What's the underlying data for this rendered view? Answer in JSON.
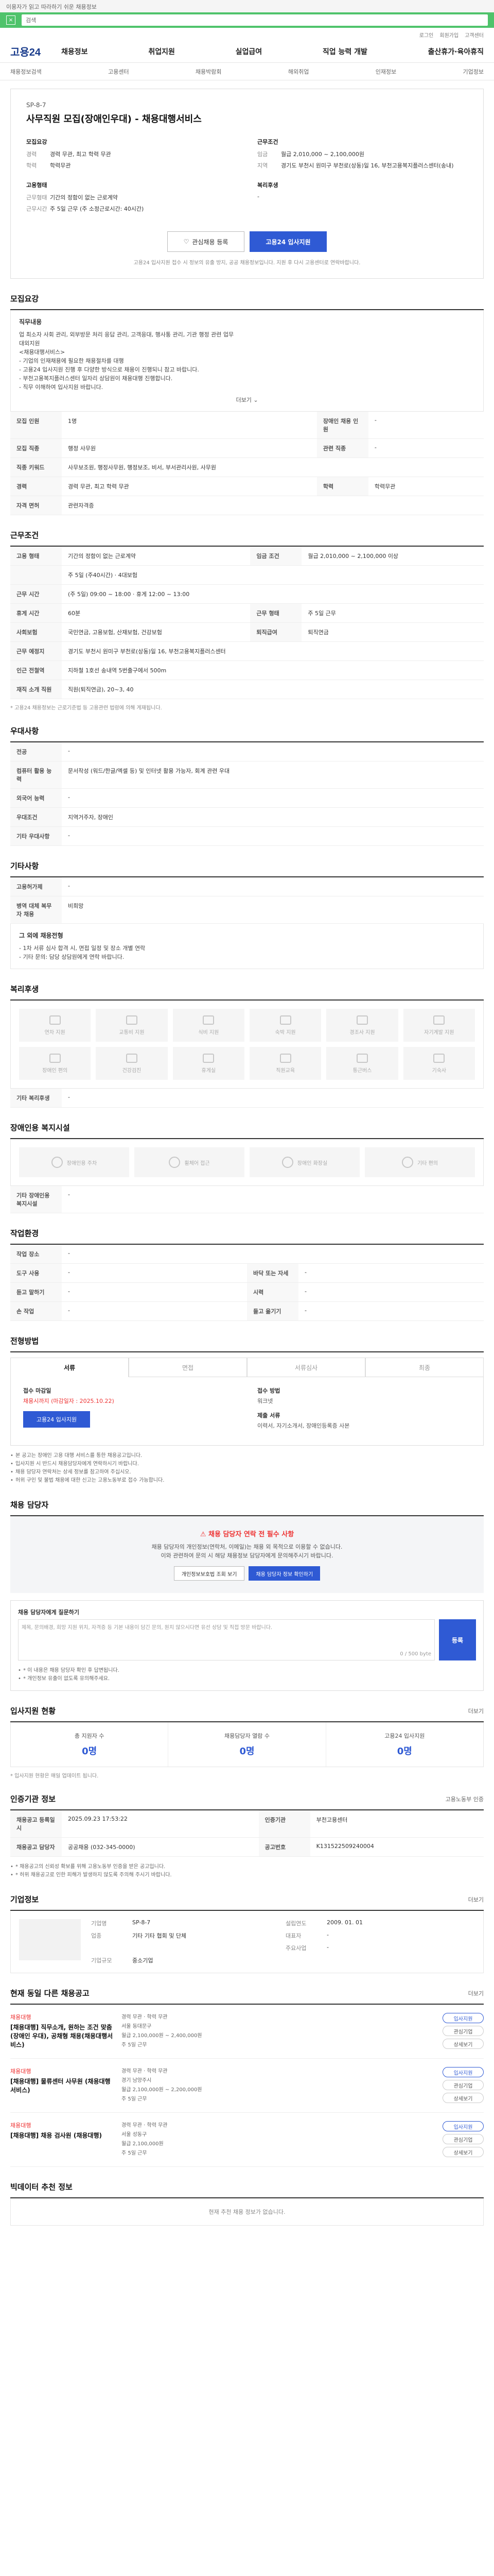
{
  "top": {
    "notice": "이용자가 읽고 따라하기 쉬운 채용정보",
    "search_close": "×",
    "search_text": "검색"
  },
  "util": [
    "로그인",
    "회원가입",
    "고객센터"
  ],
  "header": {
    "logo": "고용24",
    "gnb": [
      "채용정보",
      "취업지원",
      "실업급여",
      "직업 능력 개발",
      "출산휴가·육아휴직"
    ]
  },
  "lnb": [
    "채용정보검색",
    "고용센터",
    "채용박람회",
    "해외취업",
    "인재정보",
    "기업정보"
  ],
  "job": {
    "company": "SP-8-7",
    "title": "사무직원 모집(장애인우대) - 채용대행서비스",
    "recruit_title": "모집요강",
    "work_title": "근무조건",
    "recruit_kv": [
      {
        "k": "경력",
        "v": "경력 무관, 최고 학력 무관"
      },
      {
        "k": "학력",
        "v": "학력무관"
      }
    ],
    "work_kv": [
      {
        "k": "임금",
        "v": "월급 2,010,000 ~ 2,100,000원"
      },
      {
        "k": "지역",
        "v": "경기도 부천시 원미구 부천로(상동)일 16, 부천고용복지플러스센터(송내)"
      }
    ],
    "employ_title": "고용형태",
    "employ_kv": [
      {
        "k": "근무형태",
        "v": "기간의 정함이 없는 근로계약"
      },
      {
        "k": "근무시간",
        "v": "주 5일 근무 (주 소정근로시간: 40시간)"
      }
    ],
    "welfare_title": "복리후생",
    "welfare_kv": [
      {
        "k": "",
        "v": "-"
      }
    ],
    "interest_btn": "관심채용 등록",
    "apply_btn": "고용24 입사지원",
    "head_note": "고용24 입사지원 접수 시 정보의 유출 방지, 공공 채용정보입니다. 지원 후 다시 고용센터로 연락바랍니다."
  },
  "recruit_section": {
    "title": "모집요강",
    "duty_title": "직무내용",
    "duty_lines": [
      "업 최소자 사회 관리, 외부방문 처리 응답 관리, 고객응대, 행사통 관리, 기관 행정 관련 업무",
      "대외지원",
      "<채용대행서비스>",
      "- 기업의 인재채용에 필요한 채용절차를 대행",
      "- 고용24 입사지원 진행 후 다양한 방식으로 채용이 진행되니 참고 바랍니다.",
      "- 부천고용복지플러스센터 일자리 상담원이 채용대행 진행합니다.",
      "- 직무 이해하여 입사지원 바랍니다."
    ],
    "more": "더보기",
    "rows": [
      {
        "k": "모집 인원",
        "v": "1명",
        "k2": "장애인 채용 인원",
        "v2": "-"
      },
      {
        "k": "모집 직종",
        "v": "행정 사무원",
        "k2": "관련 직종",
        "v2": "-"
      },
      {
        "k": "직종 키워드",
        "v": "사무보조원, 행정사무원, 행정보조, 비서, 부서관리사원, 사무원",
        "k2": "",
        "v2": ""
      },
      {
        "k": "경력",
        "v": "경력 무관, 최고 학력 무관",
        "k2": "학력",
        "v2": "학력무관"
      },
      {
        "k": "자격 면허",
        "v": "관련자격증",
        "k2": "",
        "v2": ""
      }
    ]
  },
  "work_section": {
    "title": "근무조건",
    "rows": [
      {
        "k": "고용 형태",
        "v": "기간의 정함이 없는 근로계약",
        "k2": "임금 조건",
        "v2": "월급 2,010,000 ~ 2,100,000 이상"
      },
      {
        "k": "",
        "v": "주 5일 (주40시간) · 4대보험",
        "k2": "",
        "v2": ""
      },
      {
        "k": "근무 시간",
        "v": "(주 5일) 09:00 ~ 18:00 · 휴게 12:00 ~ 13:00",
        "k2": "",
        "v2": ""
      },
      {
        "k": "휴게 시간",
        "v": "60분",
        "k2": "근무 형태",
        "v2": "주 5일 근무"
      },
      {
        "k": "사회보험",
        "v": "국민연금, 고용보험, 산재보험, 건강보험",
        "k2": "퇴직급여",
        "v2": "퇴직연금"
      },
      {
        "k": "근무 예정지",
        "v": "경기도 부천시 원미구 부천로(상동)일 16, 부천고용복지플러스센터",
        "k2": "",
        "v2": ""
      },
      {
        "k": "인근 전철역",
        "v": "지하철 1호선 송내역 5번출구에서 500m",
        "k2": "",
        "v2": ""
      },
      {
        "k": "재직 소개 직원",
        "v": "직원(퇴직연금), 20~3, 40",
        "k2": "",
        "v2": ""
      }
    ],
    "note": "* 고용24 채용정보는 근로기준법 등 고용관련 법령에 의해 게재됩니다."
  },
  "pref_section": {
    "title": "우대사항",
    "rows": [
      {
        "k": "전공",
        "v": "-"
      },
      {
        "k": "컴퓨터 활용 능력",
        "v": "문서작성 (워드/한글/엑셀 등) 및 인터넷 활용 가능자, 회계 관련 우대"
      },
      {
        "k": "외국어 능력",
        "v": "-"
      },
      {
        "k": "우대조건",
        "v": "지역거주자, 장애인"
      },
      {
        "k": "기타 우대사항",
        "v": "-"
      }
    ]
  },
  "etc_section": {
    "title": "기타사항",
    "rows": [
      {
        "k": "고용허가제",
        "v": "-"
      },
      {
        "k": "병역 대체 복무자 채용",
        "v": "비희망"
      }
    ],
    "extra_title": "그 외에 채용전형",
    "extra_lines": [
      "- 1차 서류 심사 합격 시, 면접 일정 및 장소 개별 연락",
      "- 기타 문의: 담당 상담원에게 연락 바랍니다."
    ]
  },
  "welfare_section": {
    "title": "복리후생",
    "items": [
      "연차 지원",
      "교통비 지원",
      "식비 지원",
      "숙박 지원",
      "경조사 지원",
      "자기계발 지원",
      "장애인 편의",
      "건강검진",
      "휴게실",
      "직원교육",
      "통근버스",
      "기숙사"
    ],
    "etc_label": "기타 복리후생",
    "etc_value": "-"
  },
  "disabled_section": {
    "title": "장애인용 복지시설",
    "items": [
      "장애인용 주차",
      "휠체어 접근",
      "장애인 화장실",
      "기타 편의"
    ],
    "etc_label": "기타 장애인용 복지시설",
    "etc_value": "-"
  },
  "env_section": {
    "title": "작업환경",
    "rows": [
      {
        "k": "작업 장소",
        "v": "-",
        "k2": "",
        "v2": ""
      },
      {
        "k": "도구 사용",
        "v": "-",
        "k2": "바닥 또는 자세",
        "v2": "-"
      },
      {
        "k": "듣고 말하기",
        "v": "-",
        "k2": "시력",
        "v2": "-"
      },
      {
        "k": "손 작업",
        "v": "-",
        "k2": "들고 옮기기",
        "v2": "-"
      }
    ]
  },
  "apply_section": {
    "title": "전형방법",
    "tabs": [
      "서류",
      "면접",
      "서류심사",
      "최종"
    ],
    "deadline_label": "접수 마감일",
    "deadline_value": "채용시까지 (마감일자 : 2025.10.22)",
    "method_label": "접수 방법",
    "method_value": "워크넷",
    "apply_btn": "고용24 입사지원",
    "doc_label": "제출 서류",
    "doc_value": "이력서, 자기소개서, 장애인등록증 사본",
    "bullets": [
      "본 공고는 장애인 고용 대행 서비스를 통한 채용공고입니다.",
      "입사지원 시 반드시 채용담당자에게 연락하시기 바랍니다.",
      "채용 담당자 연락처는 상세 정보를 참고하여 주십시오.",
      "허위 구인 및 불법 채용에 대한 신고는 고용노동부로 접수 가능합니다."
    ]
  },
  "counsel_section": {
    "title": "채용 담당자",
    "t1": "채용 담당자 연락 전 필수 사항",
    "lines": [
      "채용 담당자의 개인정보(연락처, 이메일)는 채용 외 목적으로 이용할 수 없습니다.",
      "이와 관련하여 문의 시 해당 채용정보 담당자에게 문의해주시기 바랍니다."
    ],
    "btn1": "개인정보보호법 조회 보기",
    "btn2": "채용 담당자 정보 확인하기",
    "qa_title": "채용 담당자에게 질문하기",
    "qa_placeholder": "제목, 문의배경, 희망 지원 위치, 자격증 등 기본 내용이 담긴 문의, 원치 않으시다면 유선 상담 및 직접 방문 바랍니다.",
    "qa_counter": "0 / 500 byte",
    "qa_send": "등록",
    "qa_notes": [
      "* 이 내용은 채용 담당자 확인 후 답변됩니다.",
      "* 개인정보 유출이 없도록 유의해주세요."
    ]
  },
  "stats_section": {
    "title": "입사지원 현황",
    "more": "더보기",
    "items": [
      {
        "label": "총 지원자 수",
        "num": "0명"
      },
      {
        "label": "채용담당자 열람 수",
        "num": "0명"
      },
      {
        "label": "고용24 입사지원",
        "num": "0명"
      }
    ],
    "note": "* 입사지원 현황은 매일 업데이트 됩니다."
  },
  "info_section": {
    "title": "인증기관 정보",
    "more": "고용노동부 인증",
    "rows": [
      {
        "k": "채용공고 등록일시",
        "v": "2025.09.23 17:53:22",
        "k2": "인증기관",
        "v2": "부천고용센터"
      },
      {
        "k": "채용공고 담당자",
        "v": "공공채용 (032-345-0000)",
        "k2": "공고번호",
        "v2": "K131522509240004"
      }
    ],
    "notes": [
      "* 채용공고의 신뢰성 확보를 위해 고용노동부 인증을 받은 공고입니다.",
      "* 허위 채용공고로 인한 피해가 발생하지 않도록 주의해 주시기 바랍니다."
    ]
  },
  "company_section": {
    "title": "기업정보",
    "more": "더보기",
    "rows": [
      {
        "k": "기업명",
        "v": "SP-8-7",
        "k2": "설립연도",
        "v2": "2009. 01. 01"
      },
      {
        "k": "업종",
        "v": "기타 기타 협회 및 단체",
        "k2": "대표자",
        "v2": "-"
      },
      {
        "k": "",
        "v": "",
        "k2": "주요사업",
        "v2": "-"
      },
      {
        "k": "기업규모",
        "v": "중소기업",
        "k2": "",
        "v2": ""
      }
    ]
  },
  "similar_section": {
    "title": "현재 동일 다른 채용공고",
    "more": "더보기",
    "jobs": [
      {
        "cname": "채용대행",
        "title": "[채용대행] 직무소개, 원하는 조건 맞춤(장애인 우대), 공채형 채용(채용대행서비스)",
        "meta": [
          "경력 무관 · 학력 무관",
          "서울 동대문구",
          "월급 2,100,000원 ~ 2,400,000원",
          "주 5일 근무"
        ],
        "btns": [
          "입사지원",
          "관심기업",
          "상세보기"
        ]
      },
      {
        "cname": "채용대행",
        "title": "[채용대행] 물류센터 사무원 (채용대행서비스)",
        "meta": [
          "경력 무관 · 학력 무관",
          "경기 남양주시",
          "월급 2,100,000원 ~ 2,200,000원",
          "주 5일 근무"
        ],
        "btns": [
          "입사지원",
          "관심기업",
          "상세보기"
        ]
      },
      {
        "cname": "채용대행",
        "title": "[채용대행] 채용 검사원 (채용대행)",
        "meta": [
          "경력 무관 · 학력 무관",
          "서울 성동구",
          "월급 2,100,000원",
          "주 5일 근무"
        ],
        "btns": [
          "입사지원",
          "관심기업",
          "상세보기"
        ]
      }
    ]
  },
  "ai_section": {
    "title": "빅데이터 추천 정보",
    "empty": "현재 추천 채용 정보가 없습니다."
  },
  "colors": {
    "brand": "#2f5ad4",
    "notice_green": "#4fc36b",
    "alert_red": "#e33333"
  }
}
